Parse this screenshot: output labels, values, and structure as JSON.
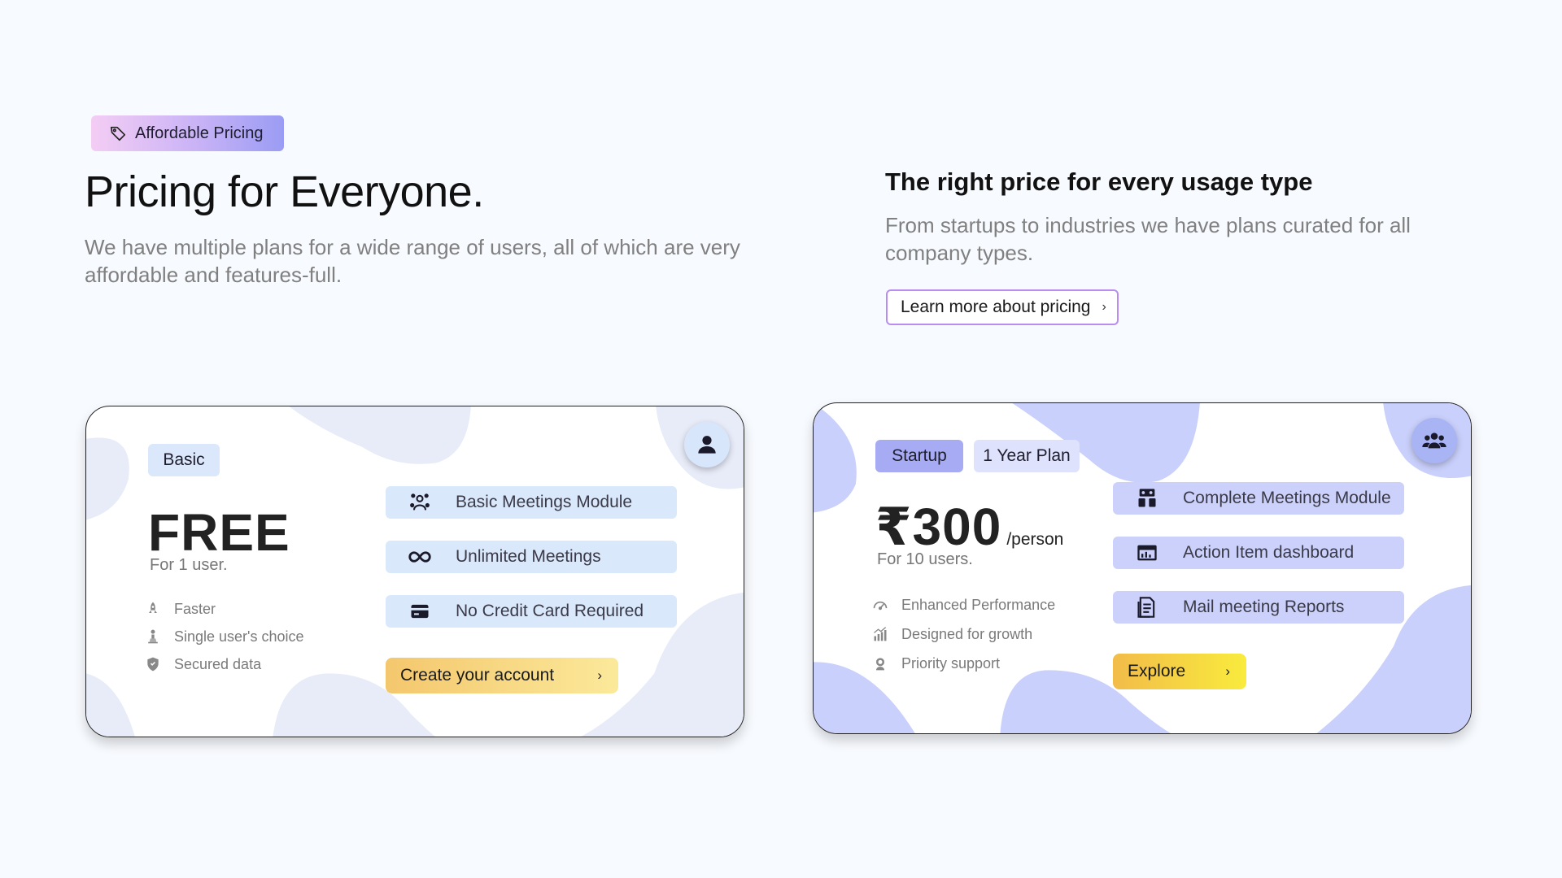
{
  "header": {
    "tag_label": "Affordable Pricing",
    "title": "Pricing for Everyone.",
    "description": "We have multiple plans for a wide range of users, all of which are very affordable and features-full.",
    "subtitle": "The right price for every usage type",
    "sub_description": "From startups to industries we have plans curated for all company types.",
    "learn_more_label": "Learn more about pricing",
    "learn_more_chevron": "›"
  },
  "basic_plan": {
    "badge": "Basic",
    "price": "FREE",
    "users": "For 1 user.",
    "highlights": [
      {
        "icon": "rocket-icon",
        "label": "Faster"
      },
      {
        "icon": "user-trophy-icon",
        "label": "Single user's choice"
      },
      {
        "icon": "shield-icon",
        "label": "Secured data"
      }
    ],
    "features": [
      {
        "icon": "meeting-module-icon",
        "label": "Basic Meetings Module"
      },
      {
        "icon": "infinity-icon",
        "label": "Unlimited Meetings"
      },
      {
        "icon": "credit-card-icon",
        "label": "No Credit Card Required"
      }
    ],
    "cta_label": "Create your account",
    "cta_chevron": "›",
    "avatar_icon": "user-icon"
  },
  "startup_plan": {
    "badge": "Startup",
    "term_badge": "1 Year Plan",
    "price": "₹300",
    "price_unit": "/person",
    "users": "For 10 users.",
    "highlights": [
      {
        "icon": "speedometer-icon",
        "label": "Enhanced Performance"
      },
      {
        "icon": "growth-chart-icon",
        "label": "Designed for growth"
      },
      {
        "icon": "support-icon",
        "label": "Priority support"
      }
    ],
    "features": [
      {
        "icon": "team-meeting-icon",
        "label": "Complete Meetings Module"
      },
      {
        "icon": "dashboard-icon",
        "label": "Action Item dashboard"
      },
      {
        "icon": "report-icon",
        "label": "Mail meeting Reports"
      }
    ],
    "cta_label": "Explore",
    "cta_chevron": "›",
    "avatar_icon": "users-group-icon"
  },
  "colors": {
    "background": "#f7fafe",
    "basic_accent": "#dae8fb",
    "startup_accent": "#ccd1fb",
    "startup_badge": "#a6abf3",
    "cta_yellow": "#f4c76d"
  }
}
